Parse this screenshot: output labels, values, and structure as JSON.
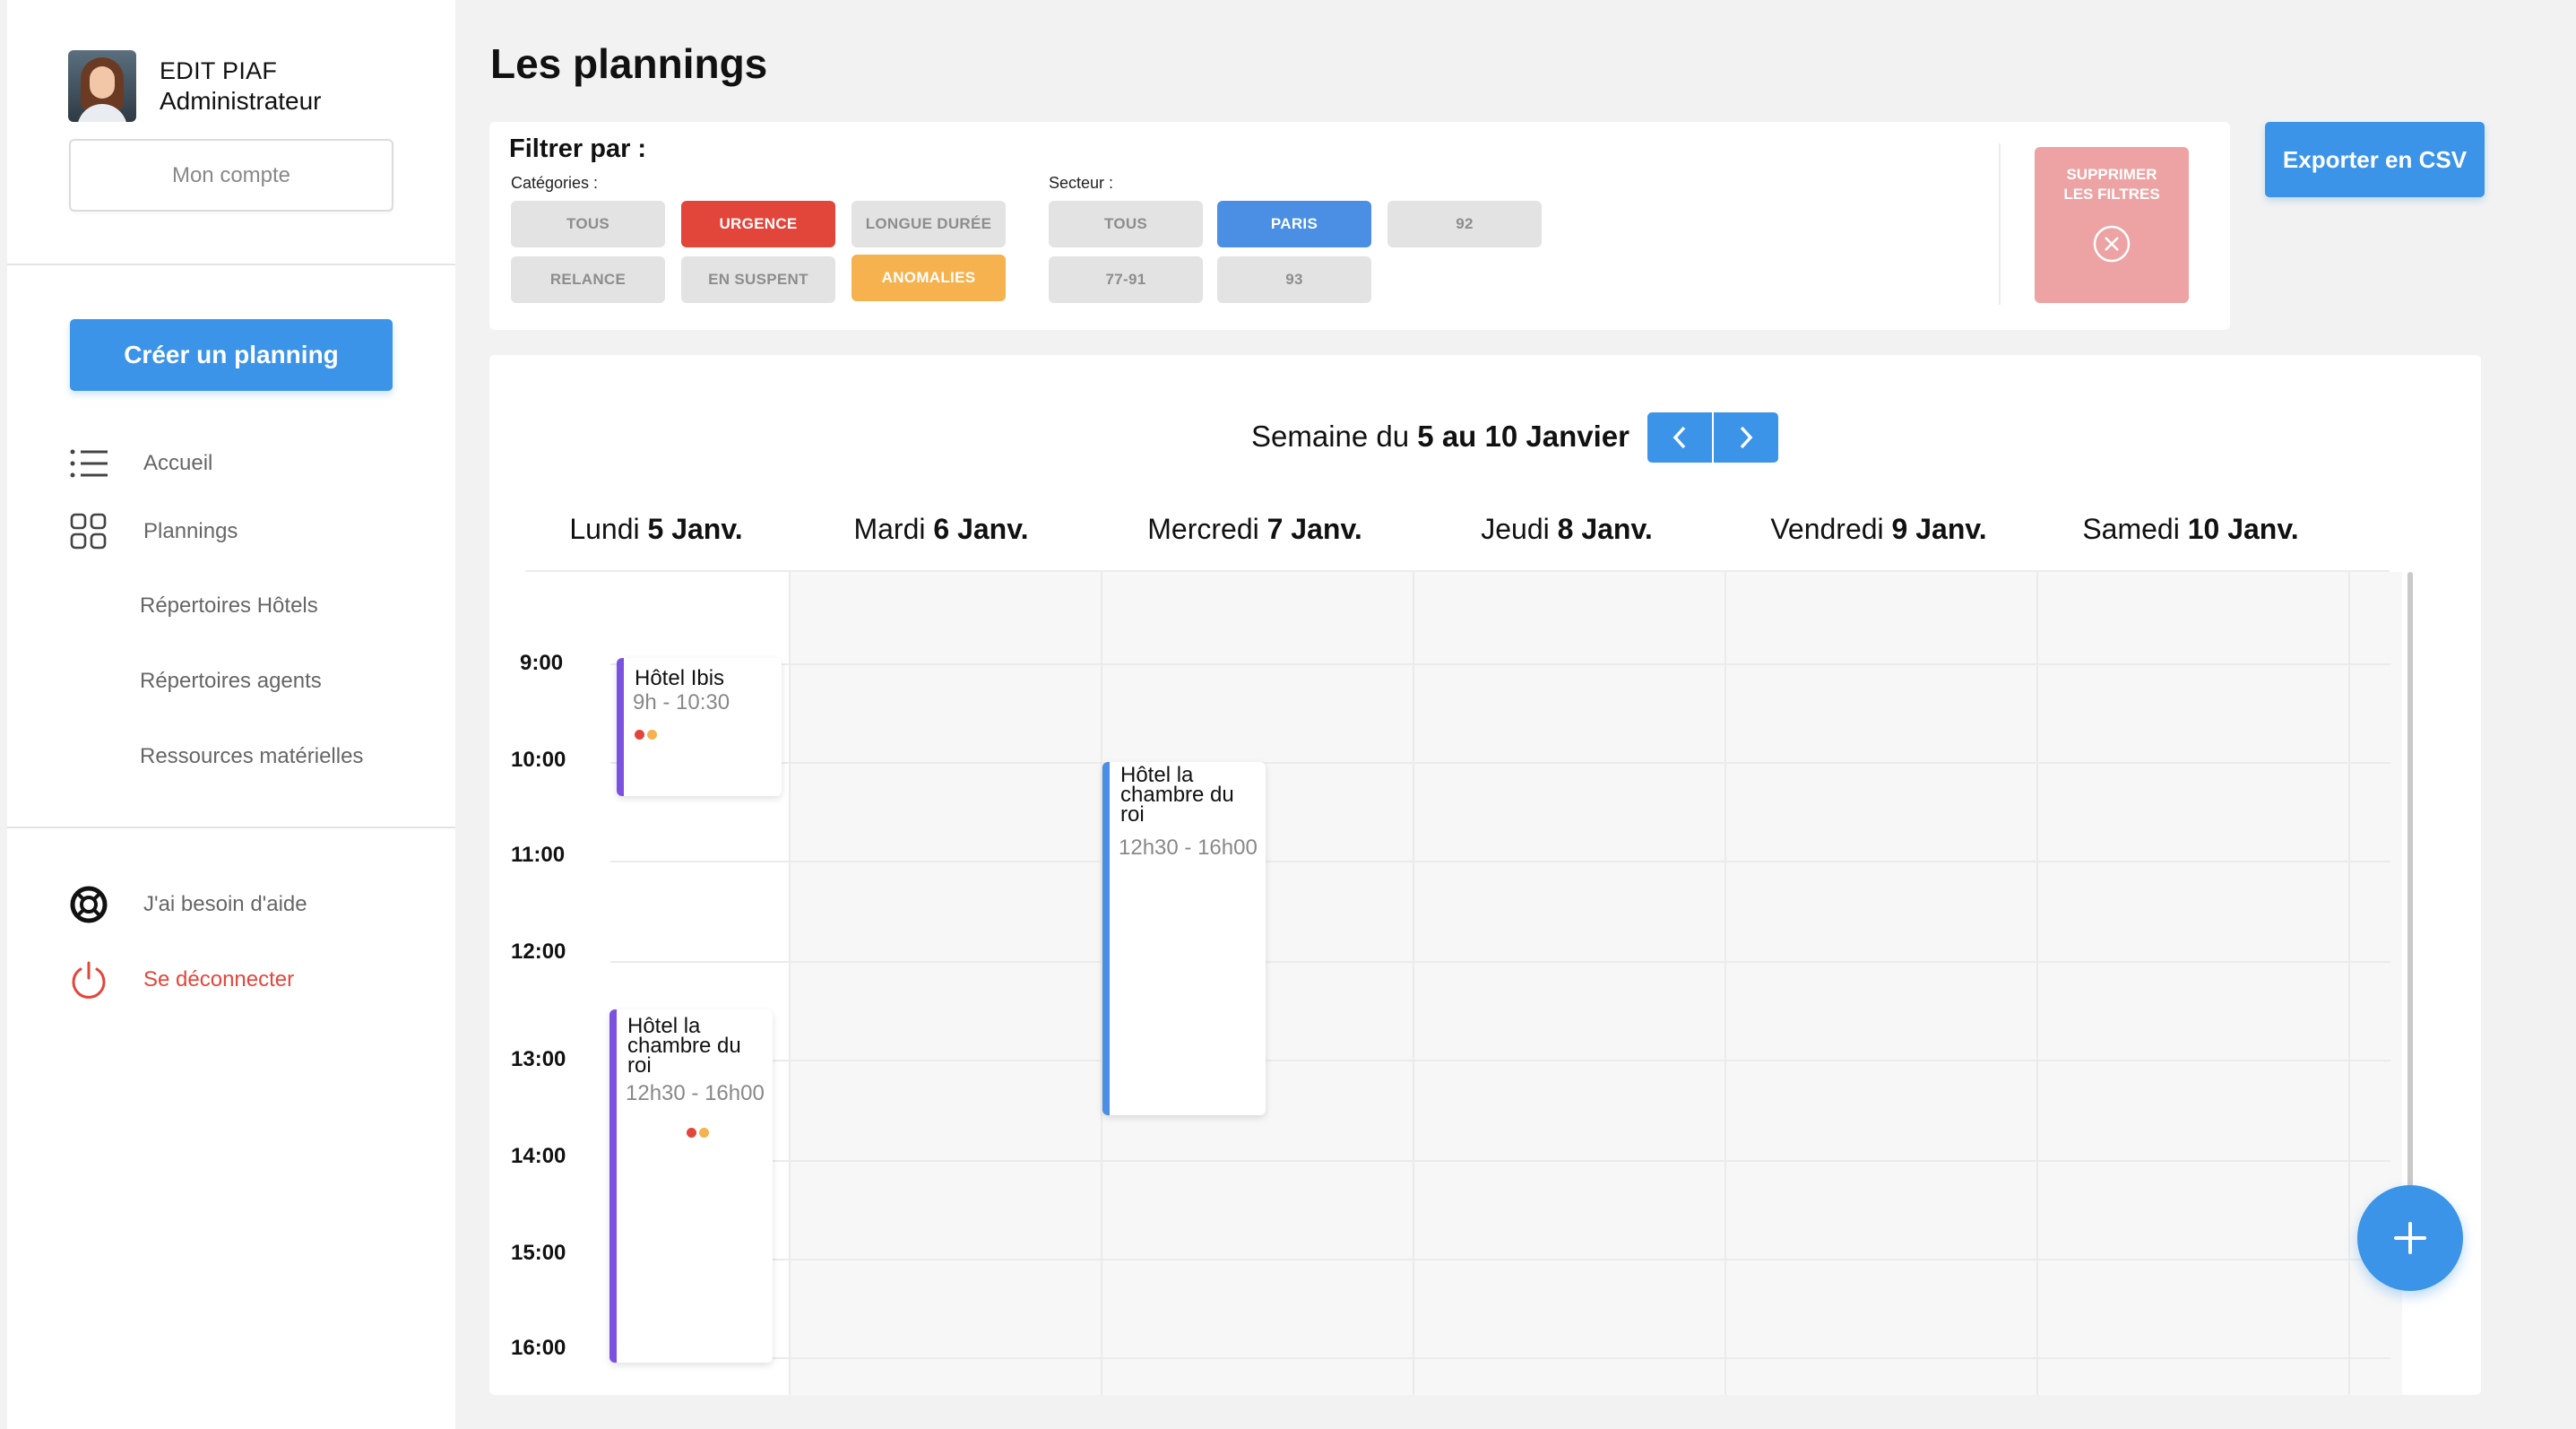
{
  "user": {
    "name": "EDIT PIAF",
    "role": "Administrateur"
  },
  "sidebar": {
    "account_label": "Mon compte",
    "create_label": "Créer un planning",
    "nav": [
      {
        "label": "Accueil",
        "icon": "list-icon"
      },
      {
        "label": "Plannings",
        "icon": "grid-icon"
      },
      {
        "label": "Répertoires Hôtels"
      },
      {
        "label": "Répertoires agents"
      },
      {
        "label": "Ressources matérielles"
      }
    ],
    "help_label": "J'ai besoin d'aide",
    "logout_label": "Se déconnecter"
  },
  "page": {
    "title": "Les plannings",
    "export_label": "Exporter en CSV"
  },
  "filters": {
    "title": "Filtrer par :",
    "categories_label": "Catégories :",
    "sector_label": "Secteur :",
    "categories": [
      {
        "label": "TOUS",
        "state": "off"
      },
      {
        "label": "URGENCE",
        "state": "red"
      },
      {
        "label": "LONGUE DURÉE",
        "state": "off"
      },
      {
        "label": "RELANCE",
        "state": "off"
      },
      {
        "label": "EN SUSPENT",
        "state": "off"
      },
      {
        "label": "ANOMALIES",
        "state": "orange"
      }
    ],
    "sectors": [
      {
        "label": "TOUS",
        "state": "off"
      },
      {
        "label": "PARIS",
        "state": "blue"
      },
      {
        "label": "92",
        "state": "off"
      },
      {
        "label": "77-91",
        "state": "off"
      },
      {
        "label": "93",
        "state": "off"
      }
    ],
    "clear_line1": "SUPPRIMER",
    "clear_line2": "LES FILTRES"
  },
  "calendar": {
    "week_prefix": "Semaine du",
    "week_range": "5 au 10 Janvier",
    "days": [
      {
        "name": "Lundi",
        "date": "5 Janv."
      },
      {
        "name": "Mardi",
        "date": "6 Janv."
      },
      {
        "name": "Mercredi",
        "date": "7 Janv."
      },
      {
        "name": "Jeudi",
        "date": "8 Janv."
      },
      {
        "name": "Vendredi",
        "date": "9 Janv."
      },
      {
        "name": "Samedi",
        "date": "10 Janv."
      }
    ],
    "hours": [
      "9:00",
      "10:00",
      "11:00",
      "12:00",
      "13:00",
      "14:00",
      "15:00",
      "16:00"
    ],
    "events": [
      {
        "title_lines": [
          "Hôtel Ibis"
        ],
        "time": "9h - 10:30",
        "day": "Lundi",
        "bar_color": "#7b52e0",
        "dots": [
          "#e2463b",
          "#f5b24e"
        ]
      },
      {
        "title_lines": [
          "Hôtel la",
          "chambre du",
          "roi"
        ],
        "time": "12h30 - 16h00",
        "day": "Mercredi",
        "bar_color": "#4a8fe3",
        "dots": []
      },
      {
        "title_lines": [
          "Hôtel la",
          "chambre du",
          "roi"
        ],
        "time": "12h30 - 16h00",
        "day": "Lundi",
        "bar_color": "#7b52e0",
        "dots": [
          "#e2463b",
          "#f5b24e"
        ]
      }
    ]
  },
  "colors": {
    "accent": "#3b94e8",
    "urgent": "#e2463b",
    "anomaly": "#f5b24e",
    "logout": "#e2463b"
  }
}
